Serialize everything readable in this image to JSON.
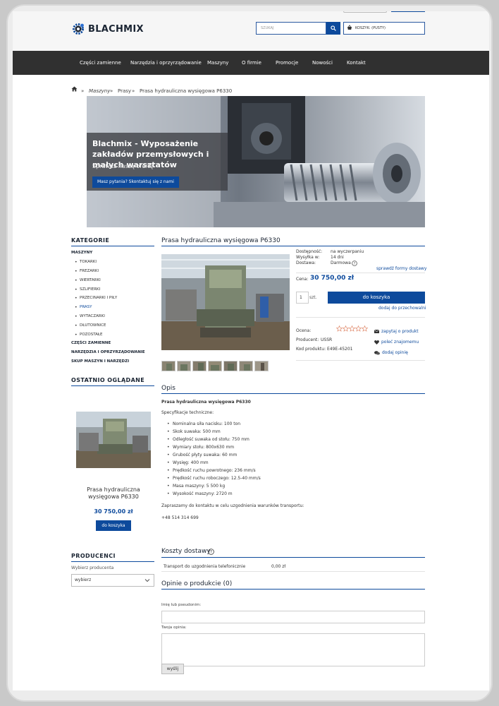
{
  "header": {
    "logo_text": "BLACHMIX",
    "search_placeholder": "SZUKAJ",
    "cart_label": "KOSZYK: (PUSTY)"
  },
  "nav": {
    "items": [
      "Części zamienne",
      "Narzędzia i oprzyrządowanie",
      "Maszyny",
      "O firmie",
      "Promocje",
      "Nowości",
      "Kontakt"
    ]
  },
  "breadcrumb": {
    "sep": "»",
    "items": [
      "Maszyny",
      "Prasy",
      "Prasa hydrauliczna wysięgowa P6330"
    ]
  },
  "hero": {
    "title": "Blachmix - Wyposażenie zakładów przemysłowych i małych warsztatów",
    "subtitle": "Sprawdź naszą ofertę",
    "button": "Masz pytania? Skontaktuj się z nami"
  },
  "sidebar": {
    "categories_title": "KATEGORIE",
    "cat_machines": "MASZYNY",
    "sub_items": [
      "TOKARKI",
      "FREZARKI",
      "WIERTARKI",
      "SZLIFIERKI",
      "PRZECINARKI I PIŁY",
      "PRASY",
      "WYTACZARKI",
      "DŁUTOWNICE",
      "POZOSTAŁE"
    ],
    "cat_other": [
      "CZĘŚCI ZAMIENNE",
      "NARZĘDZIA I OPRZYRZĄDOWANIE",
      "SKUP MASZYN I NARZĘDZI"
    ],
    "recent_title": "OSTATNIO OGLĄDANE",
    "recent_name": "Prasa hydrauliczna wysięgowa P6330",
    "recent_price": "30 750,00 zł",
    "recent_button": "do koszyka",
    "producers_title": "PRODUCENCI",
    "producers_label": "Wybierz producenta",
    "producers_selected": "wybierz"
  },
  "product": {
    "title": "Prasa hydrauliczna wysięgowa P6330",
    "availability_label": "Dostępność:",
    "availability": "na wyczerpaniu",
    "shipping_time_label": "Wysyłka w:",
    "shipping_time": "14 dni",
    "delivery_label": "Dostawa:",
    "delivery": "Darmowa",
    "delivery_link": "sprawdź formy dostawy",
    "price_label": "Cena:",
    "price": "30 750,00 zł",
    "qty": "1",
    "qty_unit": "szt.",
    "add_button": "do koszyka",
    "storage_link": "dodaj do przechowalni",
    "rating_label": "Ocena:",
    "producer_label": "Producent:",
    "producer": "USSR",
    "code_label": "Kod produktu:",
    "code": "E49E-45201",
    "actions": [
      "zapytaj o produkt",
      "poleć znajomemu",
      "dodaj opinię"
    ]
  },
  "description": {
    "title": "Opis",
    "heading": "Prasa hydrauliczna wysięgowa P6330",
    "spec_title": "Specyfikacje techniczne:",
    "specs": [
      "Nominalna siła nacisku: 100 ton",
      "Skok suwaka: 500 mm",
      "Odległość suwaka od stołu: 750 mm",
      "Wymiary stołu: 800x630 mm",
      "Grubość płyty suwaka: 60 mm",
      "Wysięg: 400 mm",
      "Prędkość ruchu powrotnego: 236 mm/s",
      "Prędkość ruchu roboczego: 12.5-40 mm/s",
      "Masa maszyny: 5 500 kg",
      "Wysokość maszyny: 2720 m"
    ],
    "contact_text": "Zapraszamy do kontaktu w celu uzgodnienia warunków transportu:",
    "phone": "+48 514 314 699"
  },
  "shipping": {
    "title": "Koszty dostawy",
    "method": "Transport do uzgodnienia telefonicznie",
    "cost": "0,00 zł"
  },
  "reviews": {
    "title": "Opinie o produkcie (0)",
    "name_label": "Imię lub pseudonim:",
    "opinion_label": "Twoja opinia:",
    "send_button": "wyślij"
  },
  "colors": {
    "accent": "#0d4a9c",
    "nav_bg": "#303030"
  }
}
